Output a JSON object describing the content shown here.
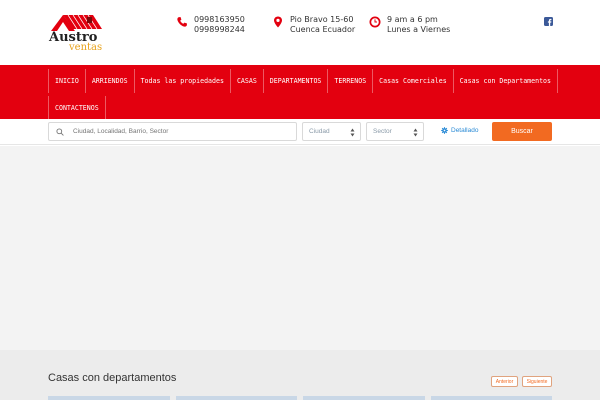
{
  "brand": {
    "line1": "Austro",
    "line2": "ventas"
  },
  "contacts": [
    {
      "icon": "phone-icon",
      "line1": "0998163950",
      "line2": "0998998244"
    },
    {
      "icon": "location-pin-icon",
      "line1": "Pio Bravo 15-60",
      "line2": "Cuenca Ecuador"
    },
    {
      "icon": "clock-icon",
      "line1": "9 am a 6 pm",
      "line2": "Lunes a Viernes"
    }
  ],
  "social": {
    "icon": "facebook-icon"
  },
  "nav": {
    "items": [
      "INICIO",
      "ARRIENDOS",
      "Todas las propiedades",
      "CASAS",
      "DEPARTAMENTOS",
      "TERRENOS",
      "Casas Comerciales",
      "Casas con Departamentos"
    ],
    "items_row2": [
      "CONTACTENOS"
    ]
  },
  "search": {
    "placeholder": "Ciudad, Localidad, Barrio, Sector",
    "city_select": "Ciudad",
    "sector_select": "Sector",
    "detailed_label": "Detallado",
    "submit_label": "Buscar"
  },
  "section": {
    "title": "Casas con departamentos",
    "prev_label": "Anterior",
    "next_label": "Siguiente"
  },
  "colors": {
    "nav": "#e3000f",
    "accent": "#f26a21",
    "link": "#2b8bd6"
  }
}
